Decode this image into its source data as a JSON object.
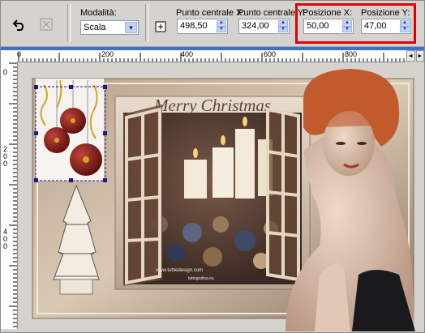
{
  "toolbar": {
    "undo_icon": "undo-arrow-icon",
    "reset_icon": "reset-transform-icon",
    "mode_label": "Modalità:",
    "mode_value": "Scala",
    "center_x_label": "Punto centrale X:",
    "center_x_value": "498,50",
    "center_y_label": "Punto centrale Y:",
    "center_y_value": "324,00",
    "pos_x_label": "Posizione X:",
    "pos_x_value": "50,00",
    "pos_y_label": "Posizione Y:",
    "pos_y_value": "47,00",
    "highlight_color": "#e00000"
  },
  "ruler": {
    "h_labels": [
      "0",
      "200",
      "400",
      "600",
      "800"
    ],
    "v_labels": [
      "0",
      "2\n0\n0",
      "4\n0\n0"
    ]
  },
  "canvas": {
    "title_text": "Merry Christmas",
    "watermark_text": "www.tuttiedesign.com",
    "watermark_small": "tuttografica.eu"
  },
  "colors": {
    "accent_blue": "#3a6fd8",
    "toolbar_bg": "#d6d3ce"
  }
}
